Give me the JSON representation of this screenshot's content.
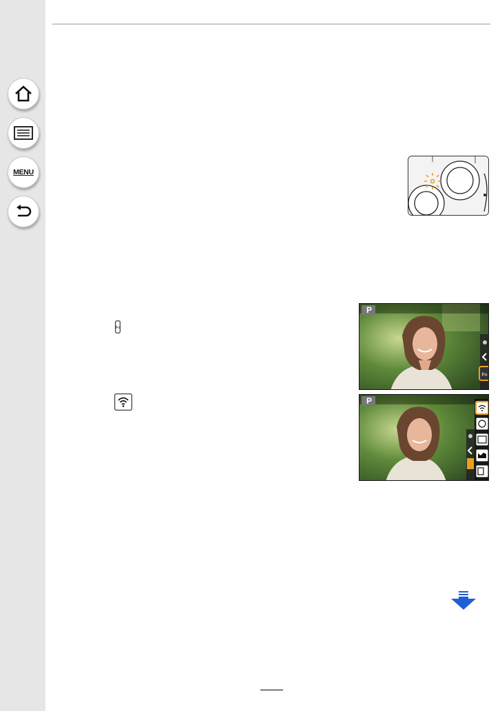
{
  "sidebar": {
    "home_icon": "house-icon",
    "contents_icon": "list-icon",
    "menu_label": "MENU",
    "back_icon": "return-arrow-icon"
  },
  "page": {
    "accent_color": "#1f5fd6",
    "rule_color": "#c5ccd6",
    "highlight_color": "#f0a020"
  },
  "screens": {
    "mode_indicator_fn": "P",
    "mode_indicator_wifi": "P",
    "fn_tab_label": "Fn"
  }
}
